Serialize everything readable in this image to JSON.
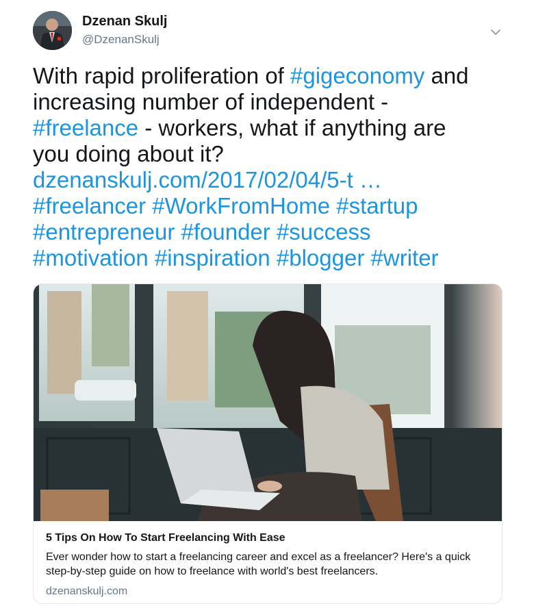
{
  "user": {
    "display_name": "Dzenan Skulj",
    "handle": "@DzenanSkulj"
  },
  "tweet": {
    "line1": {
      "text_a": "With rapid proliferation of ",
      "hashtag": "#gigeconomy",
      "text_b": " and"
    },
    "line2": "increasing number of independent -",
    "line3": {
      "hashtag": "#freelance",
      "text": " - workers, what if anything are"
    },
    "line4": "you doing about it?",
    "link": "dzenanskulj.com/2017/02/04/5-t …",
    "hashtags_line1": [
      "#freelancer",
      "#WorkFromHome",
      "#startup"
    ],
    "hashtags_line2": [
      "#entrepreneur",
      "#founder",
      "#success"
    ],
    "hashtags_line3": [
      "#motivation",
      "#inspiration",
      "#blogger",
      "#writer"
    ]
  },
  "card": {
    "title": "5 Tips On How To Start Freelancing With Ease",
    "description": "Ever wonder how to start a freelancing career and excel as a freelancer? Here's a quick step-by-step guide on how to freelance with world's best freelancers.",
    "domain": "dzenanskulj.com"
  },
  "icons": {
    "caret": "chevron-down-icon"
  },
  "colors": {
    "link": "#1b95e0",
    "text": "#14171a",
    "muted": "#657786",
    "border": "#e1e8ed"
  }
}
